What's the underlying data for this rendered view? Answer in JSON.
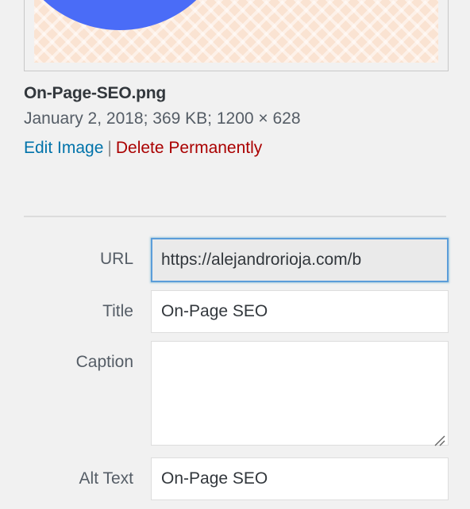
{
  "attachment": {
    "thumbnail": {
      "alt": "On-Page SEO",
      "icon_name": "circular-refresh-arrow",
      "background_color": "#fae3d2",
      "arrow_color": "#4a6cf7",
      "accent_color": "#8ed860"
    },
    "filename": "On-Page-SEO.png",
    "file_meta": "January 2, 2018;  369 KB;  1200 × 628",
    "upload_date": "January 2, 2018",
    "file_size": "369 KB",
    "dimensions": "1200 × 628",
    "actions": {
      "edit_label": "Edit Image",
      "separator": "|",
      "delete_label": "Delete Permanently",
      "edit_color": "#0073aa",
      "delete_color": "#a00"
    }
  },
  "form": {
    "fields": [
      {
        "label": "URL",
        "name": "url",
        "type": "text",
        "value": "https://alejandrorioja.com/b",
        "placeholder": "",
        "focused": true,
        "readonly": true
      },
      {
        "label": "Title",
        "name": "title",
        "type": "text",
        "value": "On-Page SEO",
        "placeholder": "",
        "focused": false,
        "readonly": false
      },
      {
        "label": "Caption",
        "name": "caption",
        "type": "textarea",
        "value": "",
        "placeholder": "",
        "focused": false,
        "readonly": false
      },
      {
        "label": "Alt Text",
        "name": "alt-text",
        "type": "text",
        "value": "On-Page SEO",
        "placeholder": "",
        "focused": false,
        "readonly": false
      }
    ]
  }
}
